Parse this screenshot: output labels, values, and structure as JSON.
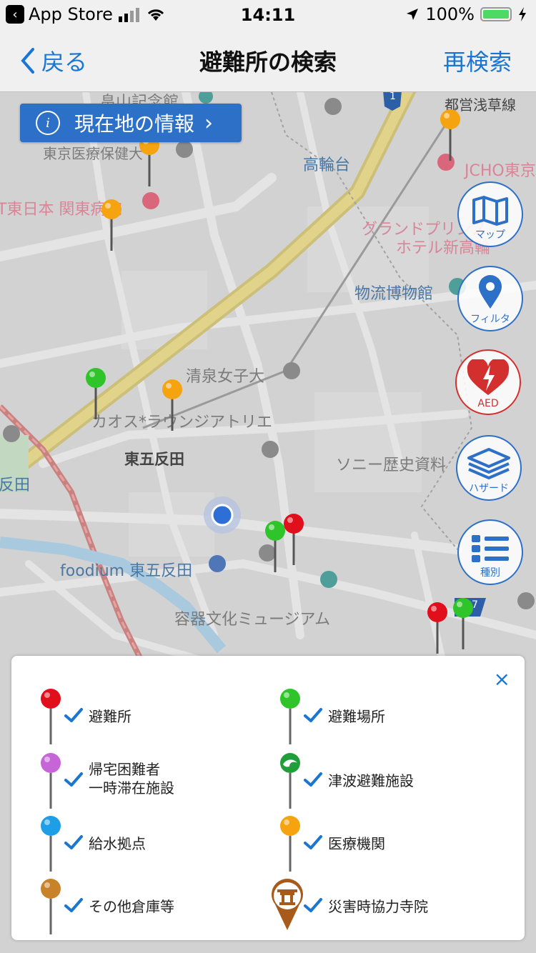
{
  "status_bar": {
    "back_app": "App Store",
    "time": "14:11",
    "battery": "100%",
    "battery_level": 1.0
  },
  "nav": {
    "back_label": "戻る",
    "title": "避難所の検索",
    "right_label": "再検索"
  },
  "map": {
    "info_button": "現在地の情報",
    "labels": {
      "hatakeyama": "畠山記念館",
      "toei_line": "都営浅草線",
      "tokyo_iryou": "東京医療保健大",
      "takanawadai": "高輪台",
      "jcho": "JCHO東京",
      "ntt": "T東日本 関東病院",
      "grand_prince": "グランドプリンス",
      "hotel_shin": "ホテル新高輪",
      "butsuryu": "物流博物館",
      "seisen": "清泉女子大",
      "kaosu": "カオス*ラウンジアトリエ",
      "higashi_gotanda": "東五反田",
      "sony": "ソニー歴史資料",
      "gotanda": "反田",
      "foodium": "foodium 東五反田",
      "youki": "容器文化ミュージアム",
      "route1": "1",
      "route7": "7"
    },
    "buttons": {
      "map": "マップ",
      "filter": "フィルタ",
      "aed": "AED",
      "hazard": "ハザード",
      "kind": "種別"
    }
  },
  "legend": {
    "close": "×",
    "items": [
      {
        "label": "避難所",
        "color": "#e10e1c"
      },
      {
        "label": "避難場所",
        "color": "#2fc42a"
      },
      {
        "label": "帰宅困難者",
        "label2": "一時滞在施設",
        "color": "#c665d8"
      },
      {
        "label": "津波避難施設",
        "color": "#1f9e3a"
      },
      {
        "label": "給水拠点",
        "color": "#1e9ee6"
      },
      {
        "label": "医療機関",
        "color": "#f5a30e"
      },
      {
        "label": "その他倉庫等",
        "color": "#c8822a"
      },
      {
        "label": "災害時協力寺院",
        "color": "#a85a1a"
      }
    ]
  }
}
